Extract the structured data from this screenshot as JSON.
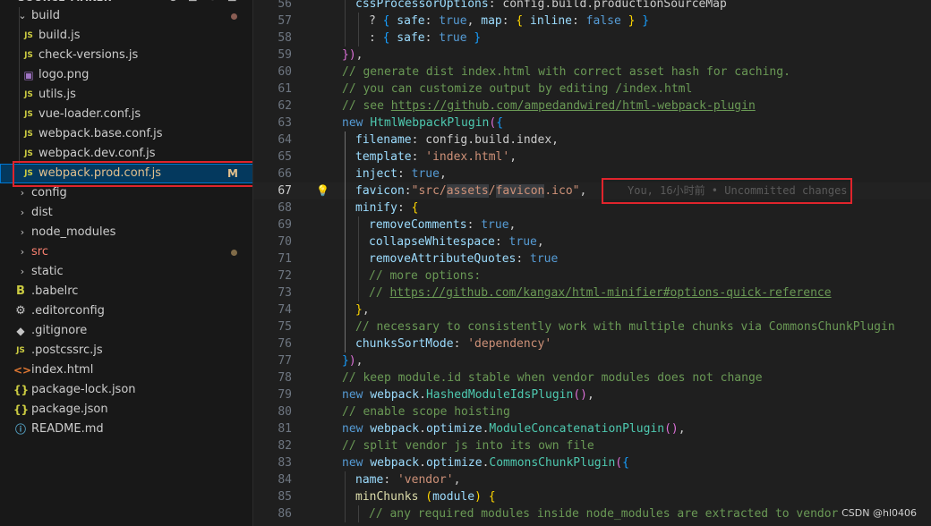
{
  "explorer": {
    "title": "SOURCE-MAKER",
    "tree": [
      {
        "name": "build",
        "kind": "folder",
        "open": true,
        "depth": 0,
        "dot": "red"
      },
      {
        "name": "build.js",
        "kind": "js",
        "depth": 1
      },
      {
        "name": "check-versions.js",
        "kind": "js",
        "depth": 1
      },
      {
        "name": "logo.png",
        "kind": "img",
        "depth": 1
      },
      {
        "name": "utils.js",
        "kind": "js",
        "depth": 1
      },
      {
        "name": "vue-loader.conf.js",
        "kind": "js",
        "depth": 1
      },
      {
        "name": "webpack.base.conf.js",
        "kind": "js",
        "depth": 1
      },
      {
        "name": "webpack.dev.conf.js",
        "kind": "js",
        "depth": 1
      },
      {
        "name": "webpack.prod.conf.js",
        "kind": "js",
        "depth": 1,
        "selected": true,
        "modified": true,
        "badge": "M"
      },
      {
        "name": "config",
        "kind": "folder",
        "open": false,
        "depth": 0
      },
      {
        "name": "dist",
        "kind": "folder",
        "open": false,
        "depth": 0
      },
      {
        "name": "node_modules",
        "kind": "folder",
        "open": false,
        "depth": 0
      },
      {
        "name": "src",
        "kind": "folder",
        "open": false,
        "depth": 0,
        "red": true,
        "dot": "olive"
      },
      {
        "name": "static",
        "kind": "folder",
        "open": false,
        "depth": 0
      },
      {
        "name": ".babelrc",
        "kind": "babel",
        "depth": 0
      },
      {
        "name": ".editorconfig",
        "kind": "gear",
        "depth": 0
      },
      {
        "name": ".gitignore",
        "kind": "git",
        "depth": 0
      },
      {
        "name": ".postcssrc.js",
        "kind": "js",
        "depth": 0
      },
      {
        "name": "index.html",
        "kind": "html",
        "depth": 0
      },
      {
        "name": "package-lock.json",
        "kind": "json",
        "depth": 0
      },
      {
        "name": "package.json",
        "kind": "json",
        "depth": 0
      },
      {
        "name": "README.md",
        "kind": "info",
        "depth": 0
      }
    ]
  },
  "icons": {
    "js": "JS",
    "img": "▣",
    "babel": "B",
    "gear": "⚙",
    "git": "◆",
    "html": "<>",
    "json": "{}",
    "info": "ⓘ",
    "chev_open": "⌄",
    "chev_closed": "›",
    "lightbulb": "💡"
  },
  "colors": {
    "selection": "#04395e",
    "modified": "#e2c08d",
    "annotation_box": "#e0242c",
    "keyword": "#569cd6",
    "string": "#ce9178",
    "comment": "#6a9955"
  },
  "editor": {
    "current_line": 67,
    "blame": "You, 16小时前 • Uncommitted changes",
    "lines": [
      {
        "n": 56,
        "indent": 1,
        "tokens": [
          [
            "prop",
            "cssProcessorOptions"
          ],
          [
            "pl",
            ": config.build.productionSourceMap"
          ]
        ]
      },
      {
        "n": 57,
        "indent": 2,
        "tokens": [
          [
            "pl",
            "? "
          ],
          [
            "bk3",
            "{"
          ],
          [
            "prop",
            " safe"
          ],
          [
            "pl",
            ": "
          ],
          [
            "kw",
            "true"
          ],
          [
            "pl",
            ", "
          ],
          [
            "prop",
            "map"
          ],
          [
            "pl",
            ": "
          ],
          [
            "bk1",
            "{"
          ],
          [
            "prop",
            " inline"
          ],
          [
            "pl",
            ": "
          ],
          [
            "kw",
            "false"
          ],
          [
            "bk1",
            " }"
          ],
          [
            "bk3",
            " }"
          ]
        ]
      },
      {
        "n": 58,
        "indent": 2,
        "tokens": [
          [
            "pl",
            ": "
          ],
          [
            "bk3",
            "{"
          ],
          [
            "prop",
            " safe"
          ],
          [
            "pl",
            ": "
          ],
          [
            "kw",
            "true"
          ],
          [
            "bk3",
            " }"
          ]
        ]
      },
      {
        "n": 59,
        "indent": 0,
        "tokens": [
          [
            "bk2",
            "})"
          ],
          [
            "pl",
            ","
          ]
        ]
      },
      {
        "n": 60,
        "indent": 0,
        "tokens": [
          [
            "cmt",
            "// generate dist index.html with correct asset hash for caching."
          ]
        ]
      },
      {
        "n": 61,
        "indent": 0,
        "tokens": [
          [
            "cmt",
            "// you can customize output by editing /index.html"
          ]
        ]
      },
      {
        "n": 62,
        "indent": 0,
        "tokens": [
          [
            "cmt",
            "// see "
          ],
          [
            "url",
            "https://github.com/ampedandwired/html-webpack-plugin"
          ]
        ]
      },
      {
        "n": 63,
        "indent": 0,
        "tokens": [
          [
            "kw",
            "new "
          ],
          [
            "cls",
            "HtmlWebpackPlugin"
          ],
          [
            "bk2",
            "("
          ],
          [
            "bk3",
            "{"
          ]
        ]
      },
      {
        "n": 64,
        "indent": 1,
        "tokens": [
          [
            "prop",
            "filename"
          ],
          [
            "pl",
            ": config.build.index,"
          ]
        ]
      },
      {
        "n": 65,
        "indent": 1,
        "tokens": [
          [
            "prop",
            "template"
          ],
          [
            "pl",
            ": "
          ],
          [
            "str",
            "'index.html'"
          ],
          [
            "pl",
            ","
          ]
        ]
      },
      {
        "n": 66,
        "indent": 1,
        "tokens": [
          [
            "prop",
            "inject"
          ],
          [
            "pl",
            ": "
          ],
          [
            "kw",
            "true"
          ],
          [
            "pl",
            ","
          ]
        ]
      },
      {
        "n": 67,
        "indent": 1,
        "tokens": [
          [
            "prop",
            "favicon"
          ],
          [
            "pl",
            ":"
          ],
          [
            "str",
            "\"src/"
          ],
          [
            "str hl",
            "assets"
          ],
          [
            "str",
            "/"
          ],
          [
            "str hl",
            "favicon"
          ],
          [
            "str",
            ".ico\""
          ],
          [
            "pl",
            ","
          ]
        ]
      },
      {
        "n": 68,
        "indent": 1,
        "tokens": [
          [
            "prop",
            "minify"
          ],
          [
            "pl",
            ": "
          ],
          [
            "bk1",
            "{"
          ]
        ]
      },
      {
        "n": 69,
        "indent": 2,
        "tokens": [
          [
            "prop",
            "removeComments"
          ],
          [
            "pl",
            ": "
          ],
          [
            "kw",
            "true"
          ],
          [
            "pl",
            ","
          ]
        ]
      },
      {
        "n": 70,
        "indent": 2,
        "tokens": [
          [
            "prop",
            "collapseWhitespace"
          ],
          [
            "pl",
            ": "
          ],
          [
            "kw",
            "true"
          ],
          [
            "pl",
            ","
          ]
        ]
      },
      {
        "n": 71,
        "indent": 2,
        "tokens": [
          [
            "prop",
            "removeAttributeQuotes"
          ],
          [
            "pl",
            ": "
          ],
          [
            "kw",
            "true"
          ]
        ]
      },
      {
        "n": 72,
        "indent": 2,
        "tokens": [
          [
            "cmt",
            "// more options:"
          ]
        ]
      },
      {
        "n": 73,
        "indent": 2,
        "tokens": [
          [
            "cmt",
            "// "
          ],
          [
            "url",
            "https://github.com/kangax/html-minifier#options-quick-reference"
          ]
        ]
      },
      {
        "n": 74,
        "indent": 1,
        "tokens": [
          [
            "bk1",
            "}"
          ],
          [
            "pl",
            ","
          ]
        ]
      },
      {
        "n": 75,
        "indent": 1,
        "tokens": [
          [
            "cmt",
            "// necessary to consistently work with multiple chunks via CommonsChunkPlugin"
          ]
        ]
      },
      {
        "n": 76,
        "indent": 1,
        "tokens": [
          [
            "prop",
            "chunksSortMode"
          ],
          [
            "pl",
            ": "
          ],
          [
            "str",
            "'dependency'"
          ]
        ]
      },
      {
        "n": 77,
        "indent": 0,
        "tokens": [
          [
            "bk3",
            "}"
          ],
          [
            "bk2",
            ")"
          ],
          [
            "pl",
            ","
          ]
        ]
      },
      {
        "n": 78,
        "indent": 0,
        "tokens": [
          [
            "cmt",
            "// keep module.id stable when vendor modules does not change"
          ]
        ]
      },
      {
        "n": 79,
        "indent": 0,
        "tokens": [
          [
            "kw",
            "new "
          ],
          [
            "prop",
            "webpack"
          ],
          [
            "pl",
            "."
          ],
          [
            "cls",
            "HashedModuleIdsPlugin"
          ],
          [
            "bk2",
            "()"
          ],
          [
            "pl",
            ","
          ]
        ]
      },
      {
        "n": 80,
        "indent": 0,
        "tokens": [
          [
            "cmt",
            "// enable scope hoisting"
          ]
        ]
      },
      {
        "n": 81,
        "indent": 0,
        "tokens": [
          [
            "kw",
            "new "
          ],
          [
            "prop",
            "webpack"
          ],
          [
            "pl",
            "."
          ],
          [
            "prop",
            "optimize"
          ],
          [
            "pl",
            "."
          ],
          [
            "cls",
            "ModuleConcatenationPlugin"
          ],
          [
            "bk2",
            "()"
          ],
          [
            "pl",
            ","
          ]
        ]
      },
      {
        "n": 82,
        "indent": 0,
        "tokens": [
          [
            "cmt",
            "// split vendor js into its own file"
          ]
        ]
      },
      {
        "n": 83,
        "indent": 0,
        "tokens": [
          [
            "kw",
            "new "
          ],
          [
            "prop",
            "webpack"
          ],
          [
            "pl",
            "."
          ],
          [
            "prop",
            "optimize"
          ],
          [
            "pl",
            "."
          ],
          [
            "cls",
            "CommonsChunkPlugin"
          ],
          [
            "bk2",
            "("
          ],
          [
            "bk3",
            "{"
          ]
        ]
      },
      {
        "n": 84,
        "indent": 1,
        "tokens": [
          [
            "prop",
            "name"
          ],
          [
            "pl",
            ": "
          ],
          [
            "str",
            "'vendor'"
          ],
          [
            "pl",
            ","
          ]
        ]
      },
      {
        "n": 85,
        "indent": 1,
        "tokens": [
          [
            "fn",
            "minChunks"
          ],
          [
            "pl",
            " "
          ],
          [
            "bk1",
            "("
          ],
          [
            "prop",
            "module"
          ],
          [
            "bk1",
            ")"
          ],
          [
            "pl",
            " "
          ],
          [
            "bk1",
            "{"
          ]
        ]
      },
      {
        "n": 86,
        "indent": 2,
        "tokens": [
          [
            "cmt",
            "// any required modules inside node_modules are extracted to vendor"
          ]
        ]
      }
    ]
  },
  "watermark": "CSDN @hl0406"
}
